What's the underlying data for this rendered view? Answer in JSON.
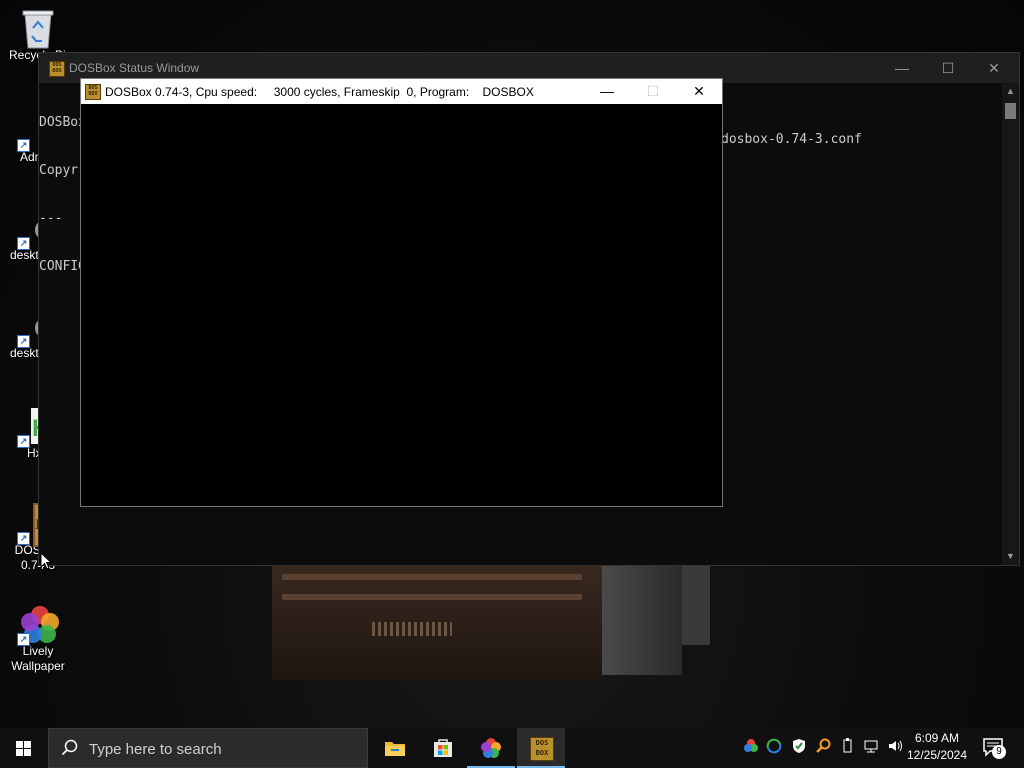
{
  "desktop": {
    "icons": [
      {
        "label": "Recycle Bin"
      },
      {
        "label": "Adm"
      },
      {
        "label": "deskt"
      },
      {
        "label": "deskt"
      },
      {
        "label": "Hx"
      },
      {
        "label": "DOSBox 0.74-3"
      },
      {
        "label": "Lively Wallpaper"
      }
    ]
  },
  "status_window": {
    "title": "DOSBox Status Window",
    "lines": [
      "DOSBox",
      "Copyr",
      "---",
      "CONFIG"
    ],
    "config_file": "dosbox-0.74-3.conf",
    "minimize": "—",
    "maximize": "☐",
    "close": "✕"
  },
  "dosbox_window": {
    "title": "DOSBox 0.74-3, Cpu speed:     3000 cycles, Frameskip  0, Program:    DOSBOX",
    "minimize": "—",
    "maximize": "☐",
    "close": "✕"
  },
  "taskbar": {
    "search_placeholder": "Type here to search",
    "clock_time": "6:09 AM",
    "clock_date": "12/25/2024",
    "notification_count": "9"
  }
}
